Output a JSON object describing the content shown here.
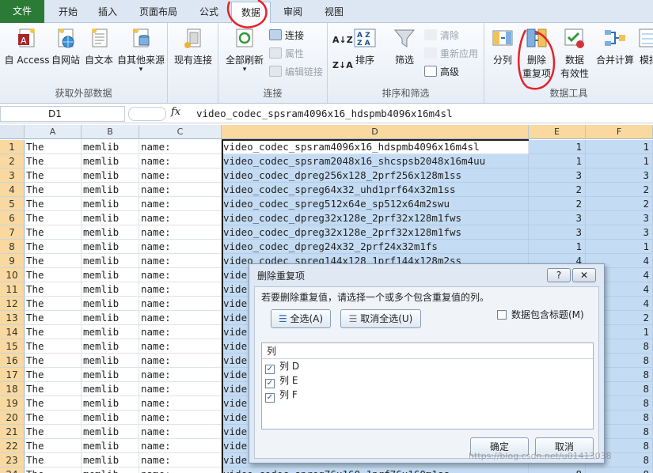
{
  "tabs": [
    "文件",
    "开始",
    "插入",
    "页面布局",
    "公式",
    "数据",
    "审阅",
    "视图"
  ],
  "ribbon": {
    "get_external": {
      "label": "获取外部数据",
      "access": "自 Access",
      "web": "自网站",
      "text": "自文本",
      "other": "自其他来源",
      "existing": "现有连接"
    },
    "connections": {
      "label": "连接",
      "refresh_all": "全部刷新",
      "connections": "连接",
      "properties": "属性",
      "edit_links": "编辑链接"
    },
    "sort_filter": {
      "label": "排序和筛选",
      "sort": "排序",
      "filter": "筛选",
      "clear": "清除",
      "reapply": "重新应用",
      "advanced": "高级"
    },
    "data_tools": {
      "label": "数据工具",
      "split": "分列",
      "remove_dup_1": "删除",
      "remove_dup_2": "重复项",
      "validation_1": "数据",
      "validation_2": "有效性",
      "consolidate": "合并计算",
      "whatif": "模拟"
    }
  },
  "formula_bar": {
    "name_box": "D1",
    "fx": "fx",
    "formula": "video_codec_spsram4096x16_hdspmb4096x16m4sl"
  },
  "columns": [
    "A",
    "B",
    "C",
    "D",
    "E",
    "F"
  ],
  "rows": [
    {
      "n": "1",
      "a": "The",
      "b": "memlib",
      "c": "name:",
      "d": "video_codec_spsram4096x16_hdspmb4096x16m4sl",
      "e": "1",
      "f": "1"
    },
    {
      "n": "2",
      "a": "The",
      "b": "memlib",
      "c": "name:",
      "d": "video_codec_spsram2048x16_shcspsb2048x16m4uu",
      "e": "1",
      "f": "1"
    },
    {
      "n": "3",
      "a": "The",
      "b": "memlib",
      "c": "name:",
      "d": "video_codec_dpreg256x128_2prf256x128m1ss",
      "e": "3",
      "f": "3"
    },
    {
      "n": "4",
      "a": "The",
      "b": "memlib",
      "c": "name:",
      "d": "video_codec_spreg64x32_uhd1prf64x32m1ss",
      "e": "2",
      "f": "2"
    },
    {
      "n": "5",
      "a": "The",
      "b": "memlib",
      "c": "name:",
      "d": "video_codec_spreg512x64e_sp512x64m2swu",
      "e": "2",
      "f": "2"
    },
    {
      "n": "6",
      "a": "The",
      "b": "memlib",
      "c": "name:",
      "d": "video_codec_dpreg32x128e_2prf32x128m1fws",
      "e": "3",
      "f": "3"
    },
    {
      "n": "7",
      "a": "The",
      "b": "memlib",
      "c": "name:",
      "d": "video_codec_dpreg32x128e_2prf32x128m1fws",
      "e": "3",
      "f": "3"
    },
    {
      "n": "8",
      "a": "The",
      "b": "memlib",
      "c": "name:",
      "d": "video_codec_dpreg24x32_2prf24x32m1fs",
      "e": "1",
      "f": "1"
    },
    {
      "n": "9",
      "a": "The",
      "b": "memlib",
      "c": "name:",
      "d": "video_codec_spreg144x128_1prf144x128m2ss",
      "e": "4",
      "f": "4"
    },
    {
      "n": "10",
      "a": "The",
      "b": "memlib",
      "c": "name:",
      "d": "vide",
      "e": "4",
      "f": "4"
    },
    {
      "n": "11",
      "a": "The",
      "b": "memlib",
      "c": "name:",
      "d": "vide",
      "e": "4",
      "f": "4"
    },
    {
      "n": "12",
      "a": "The",
      "b": "memlib",
      "c": "name:",
      "d": "vide",
      "e": "4",
      "f": "4"
    },
    {
      "n": "13",
      "a": "The",
      "b": "memlib",
      "c": "name:",
      "d": "vide",
      "e": "2",
      "f": "2"
    },
    {
      "n": "14",
      "a": "The",
      "b": "memlib",
      "c": "name:",
      "d": "vide",
      "e": "1",
      "f": "1"
    },
    {
      "n": "15",
      "a": "The",
      "b": "memlib",
      "c": "name:",
      "d": "vide",
      "e": "8",
      "f": "8"
    },
    {
      "n": "16",
      "a": "The",
      "b": "memlib",
      "c": "name:",
      "d": "vide",
      "e": "8",
      "f": "8"
    },
    {
      "n": "17",
      "a": "The",
      "b": "memlib",
      "c": "name:",
      "d": "vide",
      "e": "8",
      "f": "8"
    },
    {
      "n": "18",
      "a": "The",
      "b": "memlib",
      "c": "name:",
      "d": "vide",
      "e": "8",
      "f": "8"
    },
    {
      "n": "19",
      "a": "The",
      "b": "memlib",
      "c": "name:",
      "d": "vide",
      "e": "8",
      "f": "8"
    },
    {
      "n": "20",
      "a": "The",
      "b": "memlib",
      "c": "name:",
      "d": "vide",
      "e": "8",
      "f": "8"
    },
    {
      "n": "21",
      "a": "The",
      "b": "memlib",
      "c": "name:",
      "d": "vide",
      "e": "8",
      "f": "8"
    },
    {
      "n": "22",
      "a": "The",
      "b": "memlib",
      "c": "name:",
      "d": "vide",
      "e": "8",
      "f": "8"
    },
    {
      "n": "23",
      "a": "The",
      "b": "memlib",
      "c": "name:",
      "d": "vide",
      "e": "8",
      "f": "8"
    },
    {
      "n": "24",
      "a": "The",
      "b": "memlib",
      "c": "name:",
      "d": "video_codec_spreg76x160_1prf76x160m1ss",
      "e": "8",
      "f": "8"
    }
  ],
  "dialog": {
    "title": "删除重复项",
    "help": "?",
    "close": "✕",
    "instruction": "若要删除重复值，请选择一个或多个包含重复值的列。",
    "select_all": "全选(A)",
    "unselect_all": "取消全选(U)",
    "has_headers": "数据包含标题(M)",
    "list_header": "列",
    "items": [
      "列 D",
      "列 E",
      "列 F"
    ],
    "ok": "确定",
    "cancel": "取消"
  },
  "watermark": "https://blog.csdn.net/u01413038",
  "colors": {
    "file_tab": "#2b7a36",
    "selection": "#c4dcf3",
    "row_header_selected": "#f9d99f",
    "annotation_red": "#e8202a"
  }
}
